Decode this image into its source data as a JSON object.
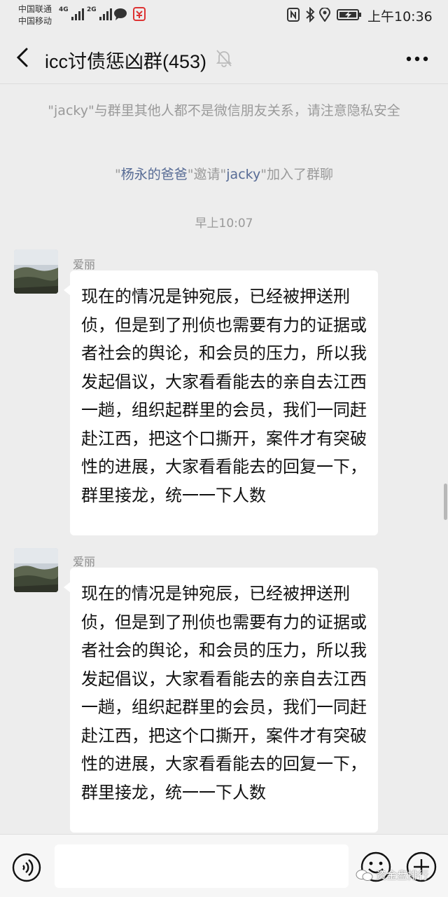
{
  "status_bar": {
    "carrier1": "中国联通",
    "carrier2": "中国移动",
    "net1": "4G",
    "net2": "2G",
    "time": "上午10:36"
  },
  "header": {
    "title": "icc讨债惩凶群(453)",
    "back_icon": "chevron-left-icon",
    "mute_icon": "bell-off-icon",
    "more_icon": "more-dots-icon"
  },
  "system_messages": {
    "privacy_notice": "\"jacky\"与群里其他人都不是微信朋友关系，请注意隐私安全",
    "invite_quote1": "\"",
    "inviter": "杨永的爸爸",
    "invite_mid": "\"邀请\"",
    "invitee": "jacky",
    "invite_tail": "\"加入了群聊"
  },
  "timestamp": "早上10:07",
  "messages": [
    {
      "sender": "爱丽",
      "text": "现在的情况是钟宛辰，已经被押送刑侦，但是到了刑侦也需要有力的证据或者社会的舆论，和会员的压力，所以我发起倡议，大家看看能去的亲自去江西一趟，组织起群里的会员，我们一同赶赴江西，把这个口撕开，案件才有突破性的进展，大家看看能去的回复一下，群里接龙，统一一下人数"
    },
    {
      "sender": "爱丽",
      "text": "现在的情况是钟宛辰，已经被押送刑侦，但是到了刑侦也需要有力的证据或者社会的舆论，和会员的压力，所以我发起倡议，大家看看能去的亲自去江西一趟，组织起群里的会员，我们一同赶赴江西，把这个口撕开，案件才有突破性的进展，大家看看能去的回复一下，群里接龙，统一一下人数"
    }
  ],
  "input_bar": {
    "voice_icon": "voice-icon",
    "emoji_icon": "emoji-icon",
    "plus_icon": "plus-icon"
  },
  "watermark": "资金盘排行",
  "colors": {
    "background": "#ededed",
    "bubble": "#ffffff",
    "link": "#576b95",
    "system_text": "#9a9a9a"
  }
}
